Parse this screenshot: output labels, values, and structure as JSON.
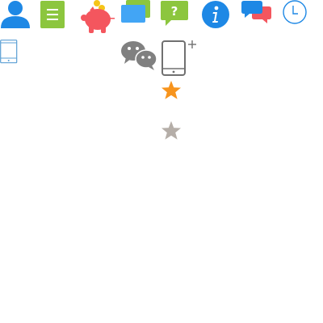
{
  "toolbar": {
    "icons": [
      {
        "name": "user-icon",
        "color": "#1e88e5"
      },
      {
        "name": "document-list-icon",
        "color": "#8cc63e"
      },
      {
        "name": "piggy-bank-icon",
        "color": "#f4565e",
        "coin_color": "#f5c518"
      },
      {
        "name": "cards-icon",
        "color": "#42a5f5",
        "back_color": "#8cc63e"
      },
      {
        "name": "help-bubble-icon",
        "color": "#8cc63e"
      },
      {
        "name": "info-icon",
        "color": "#1e88e5"
      },
      {
        "name": "chat-bubbles-icon",
        "color": "#1e88e5",
        "second_color": "#f4565e"
      },
      {
        "name": "clock-icon",
        "color": "#1e88e5"
      }
    ]
  },
  "row2": {
    "icons": [
      {
        "name": "tablet-icon",
        "color": "#5a9fd4"
      },
      {
        "name": "wechat-icon",
        "color": "#808080"
      },
      {
        "name": "phone-add-icon",
        "color": "#707070"
      }
    ]
  },
  "stars": [
    {
      "name": "star-filled-icon",
      "color": "#f7941d",
      "rating": 1
    },
    {
      "name": "star-empty-icon",
      "color": "#b5aea8",
      "rating": 0
    }
  ]
}
